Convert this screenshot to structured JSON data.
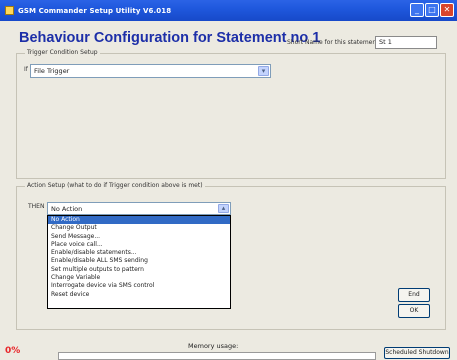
{
  "window": {
    "title": "GSM Commander Setup Utility V6.018",
    "controls": {
      "minimize": "_",
      "restore": "□",
      "close": "✕"
    }
  },
  "header": {
    "heading": "Behaviour Configuration for Statement no 1",
    "short_name_label": "Short Name for this statement:",
    "short_name_value": "St 1"
  },
  "trigger_group": {
    "legend": "Trigger Condition Setup",
    "marker": "If",
    "selected_value": "File Trigger"
  },
  "action_group": {
    "legend": "Action Setup (what to do if Trigger condition above is met)",
    "then_label": "THEN",
    "selected_value": "No Action",
    "options": [
      "No Action",
      "Change Output",
      "Send Message...",
      "Place voice call...",
      "Enable/disable statements...",
      "Enable/disable ALL SMS sending",
      "Set multiple outputs to pattern",
      "Change Variable",
      "Interrogate device via SMS control",
      "Reset device"
    ],
    "selected_index": 0
  },
  "buttons": {
    "end": "End",
    "ok": "OK",
    "scheduled_shutdown": "Scheduled Shutdown"
  },
  "status": {
    "memory_pct_text": "0%",
    "memory_label": "Memory usage:",
    "memory_fraction": 0.0
  },
  "colors": {
    "title_bar": "#1f58dd",
    "heading": "#1d2fa8",
    "selection": "#316ac5",
    "percent": "#e8262a"
  },
  "icons": {
    "app": "gsm-app-icon",
    "dropdown": "chevron-down-icon"
  }
}
